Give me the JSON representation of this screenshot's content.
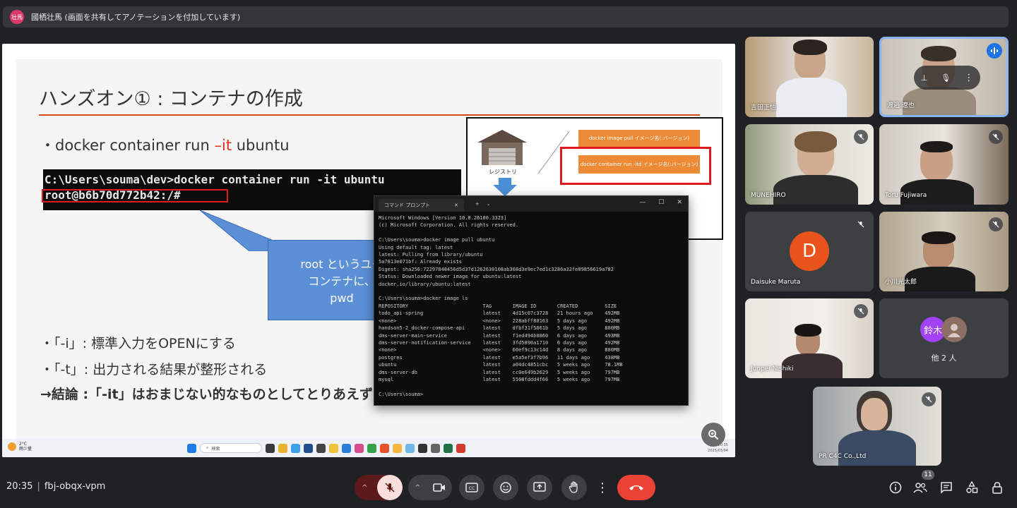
{
  "banner": {
    "avatar_text": "壮馬",
    "text": "國栖壮馬 (画面を共有してアノテーションを付加しています)"
  },
  "slide": {
    "title": "ハンズオン① : コンテナの作成",
    "cmd_prefix": "・docker container run ",
    "cmd_flag": "–it",
    "cmd_suffix": " ubuntu",
    "term_line1": "C:\\Users\\souma\\dev>docker container run -it ubuntu",
    "term_line2": "root@b6b70d772b42:/# ",
    "callout_line1": "root というユー",
    "callout_line2": "コンテナに、",
    "callout_line3": "pwd",
    "bullet1": "・「-i」: 標準入力をOPENにする",
    "bullet2": "・「-t」: 出力される結果が整形される",
    "bullet3": "→結論 :「-it」はおまじない的なものとしてとりあえずつ",
    "diagram": {
      "registry_label": "レジストリ",
      "box1": "docker image pull イメージ名(:バージョン)",
      "box2": "docker container run -itd イメージ名(:バージョン)"
    }
  },
  "cmd_window": {
    "tab_title": "コマンド プロンプト",
    "lines": "Microsoft Windows [Version 10.0.26100.3323]\n(c) Microsoft Corporation. All rights reserved.\n\nC:\\Users\\souma>docker image pull ubuntu\nUsing default tag: latest\nlatest: Pulling from library/ubuntu\n5a7813e071bf: Already exists\nDigest: sha256:72297848456d5d37d1262630108ab308d3e9ec7ed1c3286a32fe09856619a782\nStatus: Downloaded newer image for ubuntu:latest\ndocker.io/library/ubuntu:latest\n\nC:\\Users\\souma>docker image ls\nREPOSITORY                         TAG       IMAGE ID       CREATED         SIZE\ntodo_api-spring                    latest    4d15c07c3728   21 hours ago    492MB\n<none>                             <none>    228abff80163   5 days ago      492MB\nhandson5-2_docker-compose-api      latest    dfbf31f5661b   5 days ago      880MB\ndms-server-main-service            latest    f1ed494b0860   6 days ago      493MB\ndms-server-notification-service    latest    3fd5890a1710   6 days ago      492MB\n<none>                             <none>    60ef9c13c14d   8 days ago      880MB\npostgres                           latest    e5a5ef3f7b96   11 days ago     438MB\nubuntu                             latest    a04dc4851cbc   5 weeks ago     78.1MB\ndms-server-db                      latest    cc0e649b2629   5 weeks ago     797MB\nmysql                              latest    5568fddd4f66   5 weeks ago     797MB\n\nC:\\Users\\souma>"
  },
  "taskbar": {
    "weather_temp": "2°C",
    "weather_desc": "雨少量",
    "search_placeholder": "検索",
    "clock_time": "20:35",
    "clock_date": "2025/03/04"
  },
  "participants": [
    {
      "name": "吉田正悟"
    },
    {
      "name": "渡邉 遼也"
    },
    {
      "name": "MUNEHIRO"
    },
    {
      "name": "Toru Fujiwara"
    },
    {
      "name": "Daisuke Maruta",
      "initial": "D"
    },
    {
      "name": "小川光太郎"
    },
    {
      "name": "Junpei Nishiki"
    },
    {
      "name": "PR C4C Co.,Ltd"
    }
  ],
  "others": {
    "avatar_text": "鈴木",
    "label": "他 2 人"
  },
  "meeting": {
    "time": "20:35",
    "code": "fbj-obqx-vpm",
    "participant_count": "11"
  },
  "colors": {
    "accent_red": "#e0311f",
    "end_call": "#ea4335",
    "speaking_border": "#8ab4f8",
    "avatar_d": "#e8541b"
  }
}
